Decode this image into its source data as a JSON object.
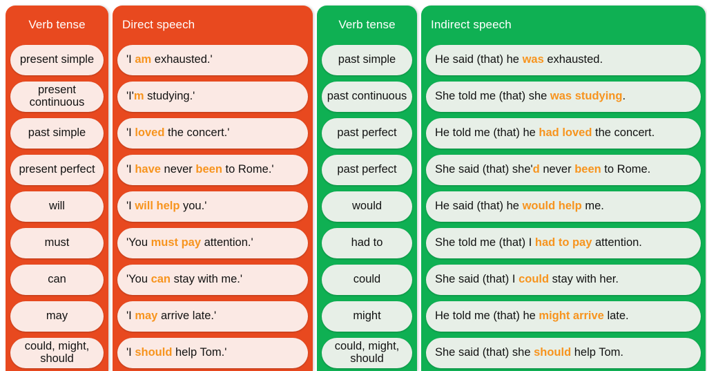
{
  "colors": {
    "direct_panel": "#e8491f",
    "indirect_panel": "#0fb053",
    "direct_pill": "#fbe9e4",
    "indirect_pill": "#e7efe7",
    "highlight": "#f7941e",
    "header_text": "#ffffff",
    "body_text": "#111111"
  },
  "columns": {
    "direct_tense_header": "Verb tense",
    "direct_speech_header": "Direct speech",
    "indirect_tense_header": "Verb tense",
    "indirect_speech_header": "Indirect speech"
  },
  "rows": [
    {
      "direct_tense": "present simple",
      "direct_speech": [
        {
          "t": "'I ",
          "hl": false
        },
        {
          "t": "am",
          "hl": true
        },
        {
          "t": " exhausted.'",
          "hl": false
        }
      ],
      "indirect_tense": "past simple",
      "indirect_speech": [
        {
          "t": "He said (that) he ",
          "hl": false
        },
        {
          "t": "was",
          "hl": true
        },
        {
          "t": " exhausted.",
          "hl": false
        }
      ]
    },
    {
      "direct_tense": "present continuous",
      "direct_speech": [
        {
          "t": "'I'",
          "hl": false
        },
        {
          "t": "m",
          "hl": true
        },
        {
          "t": " studying.'",
          "hl": false
        }
      ],
      "indirect_tense": "past continuous",
      "indirect_speech": [
        {
          "t": "She told me (that) she ",
          "hl": false
        },
        {
          "t": "was studying",
          "hl": true
        },
        {
          "t": ".",
          "hl": false
        }
      ]
    },
    {
      "direct_tense": "past simple",
      "direct_speech": [
        {
          "t": "'I ",
          "hl": false
        },
        {
          "t": "loved",
          "hl": true
        },
        {
          "t": " the concert.'",
          "hl": false
        }
      ],
      "indirect_tense": "past perfect",
      "indirect_speech": [
        {
          "t": "He told me (that) he ",
          "hl": false
        },
        {
          "t": "had loved",
          "hl": true
        },
        {
          "t": " the concert.",
          "hl": false
        }
      ]
    },
    {
      "direct_tense": "present perfect",
      "direct_speech": [
        {
          "t": "'I ",
          "hl": false
        },
        {
          "t": "have",
          "hl": true
        },
        {
          "t": " never ",
          "hl": false
        },
        {
          "t": "been",
          "hl": true
        },
        {
          "t": " to Rome.'",
          "hl": false
        }
      ],
      "indirect_tense": "past perfect",
      "indirect_speech": [
        {
          "t": "She said (that) she'",
          "hl": false
        },
        {
          "t": "d",
          "hl": true
        },
        {
          "t": " never ",
          "hl": false
        },
        {
          "t": "been",
          "hl": true
        },
        {
          "t": " to Rome.",
          "hl": false
        }
      ]
    },
    {
      "direct_tense": "will",
      "direct_speech": [
        {
          "t": "'I ",
          "hl": false
        },
        {
          "t": "will help",
          "hl": true
        },
        {
          "t": " you.'",
          "hl": false
        }
      ],
      "indirect_tense": "would",
      "indirect_speech": [
        {
          "t": "He said (that) he ",
          "hl": false
        },
        {
          "t": "would help",
          "hl": true
        },
        {
          "t": " me.",
          "hl": false
        }
      ]
    },
    {
      "direct_tense": "must",
      "direct_speech": [
        {
          "t": "'You ",
          "hl": false
        },
        {
          "t": "must pay",
          "hl": true
        },
        {
          "t": " attention.'",
          "hl": false
        }
      ],
      "indirect_tense": "had to",
      "indirect_speech": [
        {
          "t": "She told me (that) I ",
          "hl": false
        },
        {
          "t": "had to pay",
          "hl": true
        },
        {
          "t": " attention.",
          "hl": false
        }
      ]
    },
    {
      "direct_tense": "can",
      "direct_speech": [
        {
          "t": "'You ",
          "hl": false
        },
        {
          "t": "can",
          "hl": true
        },
        {
          "t": " stay with me.'",
          "hl": false
        }
      ],
      "indirect_tense": "could",
      "indirect_speech": [
        {
          "t": "She said (that) I ",
          "hl": false
        },
        {
          "t": "could",
          "hl": true
        },
        {
          "t": " stay with her.",
          "hl": false
        }
      ]
    },
    {
      "direct_tense": "may",
      "direct_speech": [
        {
          "t": "'I ",
          "hl": false
        },
        {
          "t": "may",
          "hl": true
        },
        {
          "t": " arrive late.'",
          "hl": false
        }
      ],
      "indirect_tense": "might",
      "indirect_speech": [
        {
          "t": "He told me (that) he ",
          "hl": false
        },
        {
          "t": "might arrive",
          "hl": true
        },
        {
          "t": " late.",
          "hl": false
        }
      ]
    },
    {
      "direct_tense": "could, might, should",
      "direct_speech": [
        {
          "t": "'I ",
          "hl": false
        },
        {
          "t": "should",
          "hl": true
        },
        {
          "t": " help Tom.'",
          "hl": false
        }
      ],
      "indirect_tense": "could, might, should",
      "indirect_speech": [
        {
          "t": "She said (that) she ",
          "hl": false
        },
        {
          "t": "should",
          "hl": true
        },
        {
          "t": " help Tom.",
          "hl": false
        }
      ]
    }
  ]
}
